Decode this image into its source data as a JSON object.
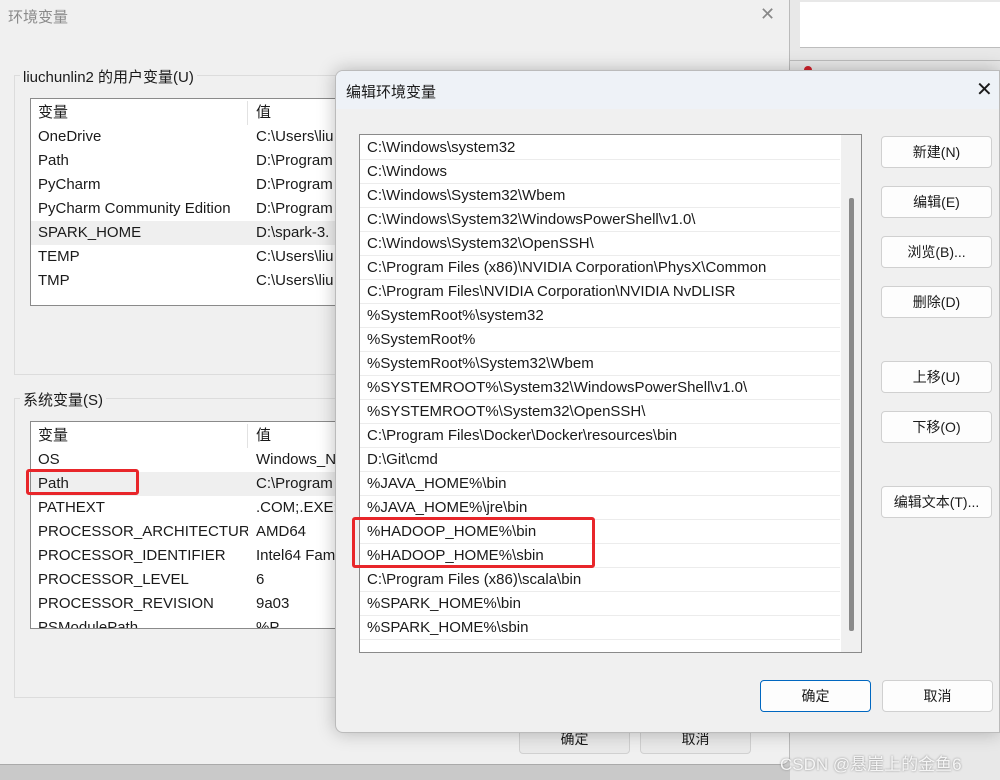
{
  "main_dialog": {
    "title": "环境变量",
    "user_group_label": "liuchunlin2 的用户变量(U)",
    "system_group_label": "系统变量(S)",
    "columns": [
      "变量",
      "值"
    ],
    "user_vars": [
      {
        "name": "OneDrive",
        "value": "C:\\Users\\liu"
      },
      {
        "name": "Path",
        "value": "D:\\Program"
      },
      {
        "name": "PyCharm",
        "value": "D:\\Program"
      },
      {
        "name": "PyCharm Community Edition",
        "value": "D:\\Program"
      },
      {
        "name": "SPARK_HOME",
        "value": "D:\\spark-3."
      },
      {
        "name": "TEMP",
        "value": "C:\\Users\\liu"
      },
      {
        "name": "TMP",
        "value": "C:\\Users\\liu"
      }
    ],
    "system_vars": [
      {
        "name": "OS",
        "value": "Windows_N"
      },
      {
        "name": "Path",
        "value": "C:\\Program"
      },
      {
        "name": "PATHEXT",
        "value": ".COM;.EXE;"
      },
      {
        "name": "PROCESSOR_ARCHITECTURE",
        "value": "AMD64"
      },
      {
        "name": "PROCESSOR_IDENTIFIER",
        "value": "Intel64 Fam"
      },
      {
        "name": "PROCESSOR_LEVEL",
        "value": "6"
      },
      {
        "name": "PROCESSOR_REVISION",
        "value": "9a03"
      },
      {
        "name": "PSModulePath",
        "value": "%P"
      }
    ],
    "ok_label": "确定",
    "cancel_label": "取消"
  },
  "edit_dialog": {
    "title": "编辑环境变量",
    "paths": [
      "C:\\Windows\\system32",
      "C:\\Windows",
      "C:\\Windows\\System32\\Wbem",
      "C:\\Windows\\System32\\WindowsPowerShell\\v1.0\\",
      "C:\\Windows\\System32\\OpenSSH\\",
      "C:\\Program Files (x86)\\NVIDIA Corporation\\PhysX\\Common",
      "C:\\Program Files\\NVIDIA Corporation\\NVIDIA NvDLISR",
      "%SystemRoot%\\system32",
      "%SystemRoot%",
      "%SystemRoot%\\System32\\Wbem",
      "%SYSTEMROOT%\\System32\\WindowsPowerShell\\v1.0\\",
      "%SYSTEMROOT%\\System32\\OpenSSH\\",
      "C:\\Program Files\\Docker\\Docker\\resources\\bin",
      "D:\\Git\\cmd",
      "%JAVA_HOME%\\bin",
      "%JAVA_HOME%\\jre\\bin",
      "%HADOOP_HOME%\\bin",
      "%HADOOP_HOME%\\sbin",
      "C:\\Program Files (x86)\\scala\\bin",
      "%SPARK_HOME%\\bin",
      "%SPARK_HOME%\\sbin"
    ],
    "buttons": {
      "new": "新建(N)",
      "edit": "编辑(E)",
      "browse": "浏览(B)...",
      "delete": "删除(D)",
      "move_up": "上移(U)",
      "move_down": "下移(O)",
      "edit_text": "编辑文本(T)..."
    },
    "ok_label": "确定",
    "cancel_label": "取消"
  },
  "watermark": "CSDN @悬崖上的金鱼6",
  "colors": {
    "highlight_box": "#e8262a",
    "default_button_border": "#0067c0"
  }
}
